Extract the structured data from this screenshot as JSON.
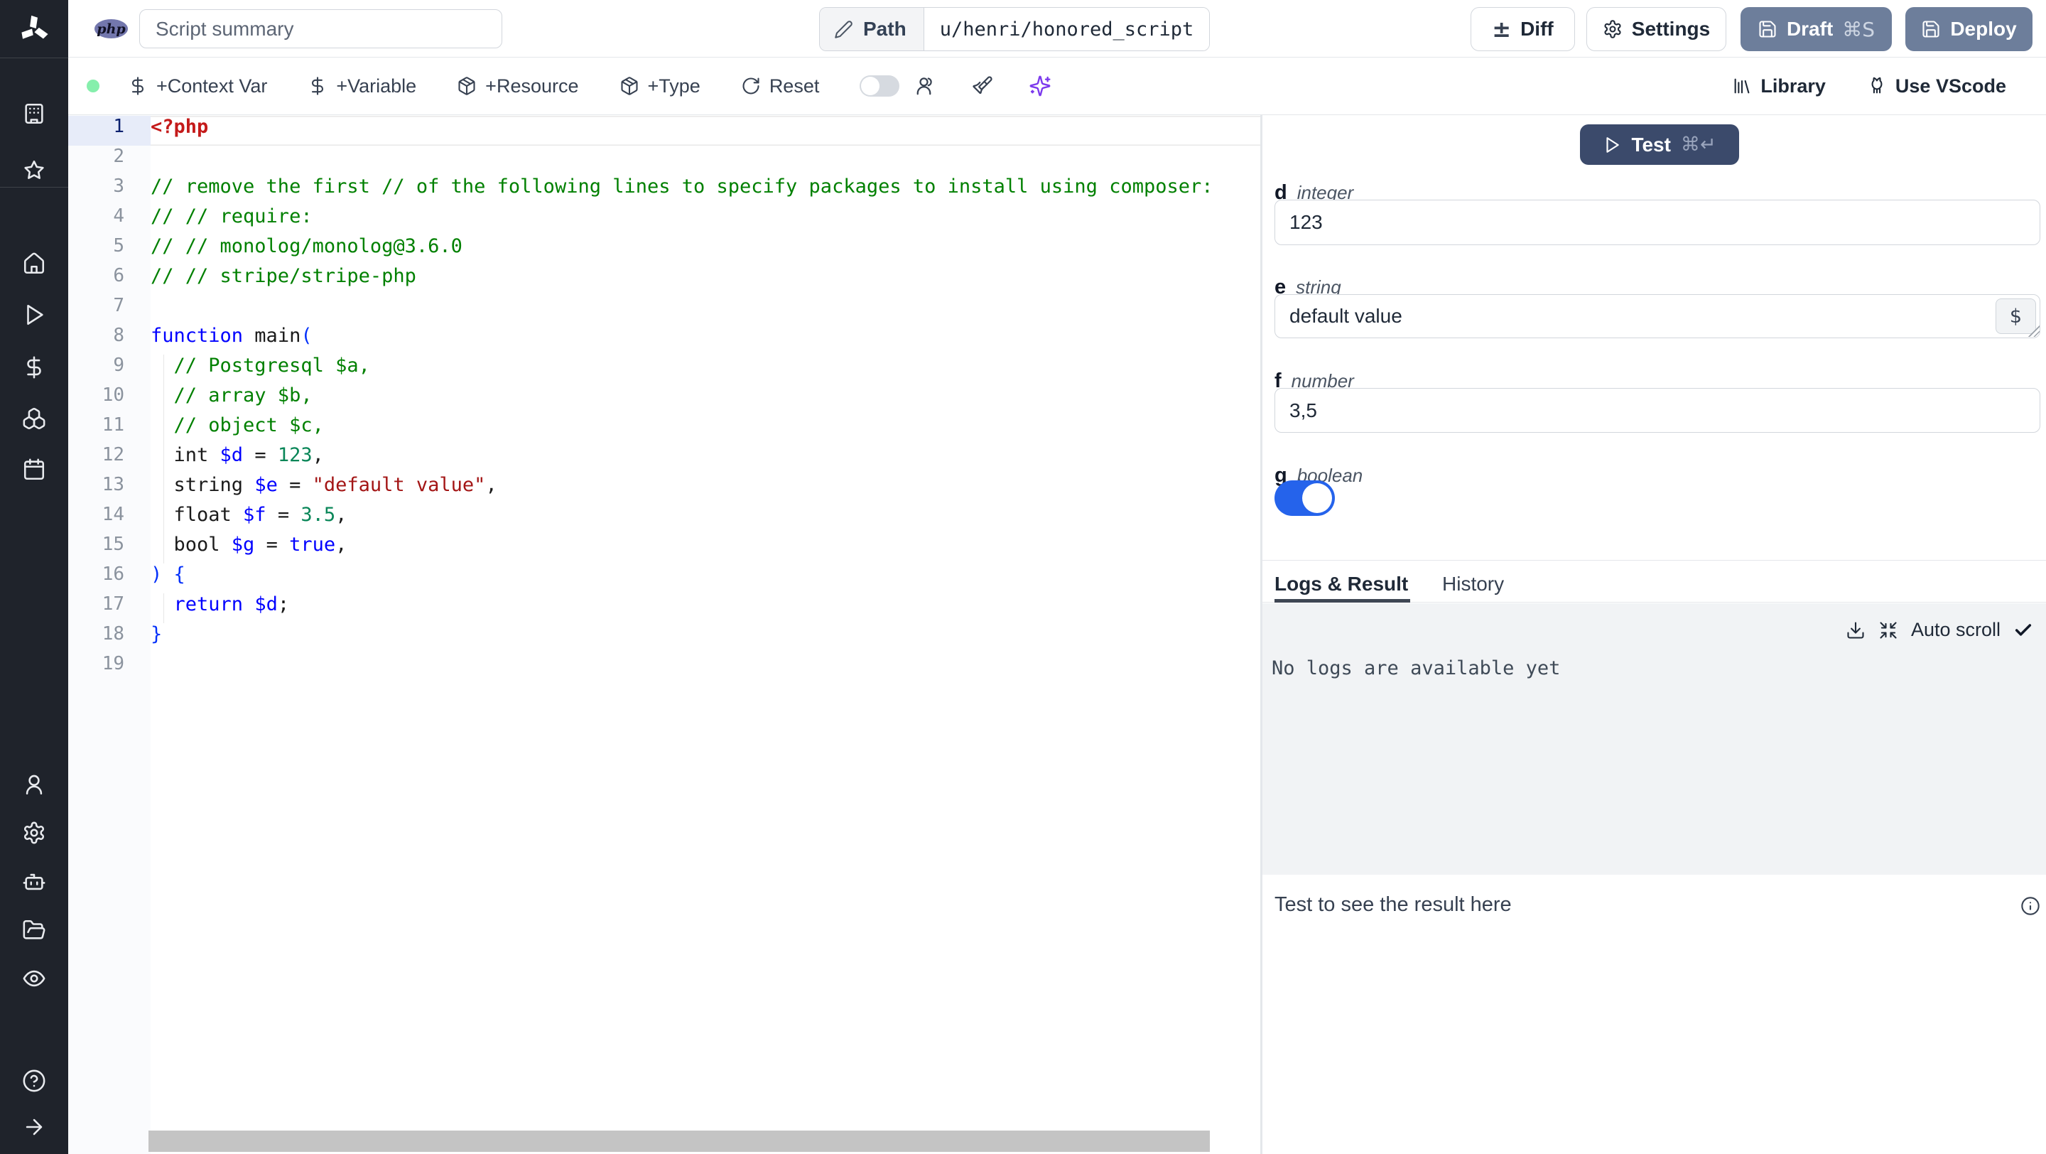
{
  "topbar": {
    "language": "php",
    "summary_placeholder": "Script summary",
    "path_label": "Path",
    "path_value": "u/henri/honored_script",
    "diff": "Diff",
    "settings": "Settings",
    "draft": "Draft",
    "draft_shortcut": "⌘S",
    "deploy": "Deploy"
  },
  "toolbar": {
    "add_context_var": "+Context Var",
    "add_variable": "+Variable",
    "add_resource": "+Resource",
    "add_type": "+Type",
    "reset": "Reset",
    "library": "Library",
    "use_vscode": "Use VScode"
  },
  "editor": {
    "lines": [
      {
        "n": 1,
        "current": true,
        "t": [
          [
            "r",
            "<?php"
          ]
        ]
      },
      {
        "n": 2,
        "t": []
      },
      {
        "n": 3,
        "t": [
          [
            "c",
            "// remove the first // of the following lines to specify packages to install using composer:"
          ]
        ]
      },
      {
        "n": 4,
        "t": [
          [
            "c",
            "// // require:"
          ]
        ]
      },
      {
        "n": 5,
        "t": [
          [
            "c",
            "// // monolog/monolog@3.6.0"
          ]
        ]
      },
      {
        "n": 6,
        "t": [
          [
            "c",
            "// // stripe/stripe-php"
          ]
        ]
      },
      {
        "n": 7,
        "t": []
      },
      {
        "n": 8,
        "t": [
          [
            "k",
            "function"
          ],
          [
            "p",
            " main"
          ],
          [
            "b",
            "("
          ]
        ]
      },
      {
        "n": 9,
        "g": 1,
        "t": [
          [
            "c",
            "  // Postgresql $a,"
          ]
        ]
      },
      {
        "n": 10,
        "g": 1,
        "t": [
          [
            "c",
            "  // array $b,"
          ]
        ]
      },
      {
        "n": 11,
        "g": 1,
        "t": [
          [
            "c",
            "  // object $c,"
          ]
        ]
      },
      {
        "n": 12,
        "g": 1,
        "t": [
          [
            "p",
            "  int "
          ],
          [
            "v",
            "$d"
          ],
          [
            "p",
            " = "
          ],
          [
            "n2",
            "123"
          ],
          [
            "p",
            ","
          ]
        ]
      },
      {
        "n": 13,
        "g": 1,
        "t": [
          [
            "p",
            "  string "
          ],
          [
            "v",
            "$e"
          ],
          [
            "p",
            " = "
          ],
          [
            "s",
            "\"default value\""
          ],
          [
            "p",
            ","
          ]
        ]
      },
      {
        "n": 14,
        "g": 1,
        "t": [
          [
            "p",
            "  float "
          ],
          [
            "v",
            "$f"
          ],
          [
            "p",
            " = "
          ],
          [
            "n2",
            "3.5"
          ],
          [
            "p",
            ","
          ]
        ]
      },
      {
        "n": 15,
        "g": 1,
        "t": [
          [
            "p",
            "  bool "
          ],
          [
            "v",
            "$g"
          ],
          [
            "p",
            " = "
          ],
          [
            "k",
            "true"
          ],
          [
            "p",
            ","
          ]
        ]
      },
      {
        "n": 16,
        "t": [
          [
            "b",
            ") {"
          ]
        ]
      },
      {
        "n": 17,
        "g": 1,
        "t": [
          [
            "p",
            "  "
          ],
          [
            "k",
            "return"
          ],
          [
            "p",
            " "
          ],
          [
            "v",
            "$d"
          ],
          [
            "p",
            ";"
          ]
        ]
      },
      {
        "n": 18,
        "t": [
          [
            "b",
            "}"
          ]
        ]
      },
      {
        "n": 19,
        "t": []
      }
    ]
  },
  "panel": {
    "test": "Test",
    "test_shortcut": "⌘↵",
    "fields": [
      {
        "name": "d",
        "type": "integer",
        "value": "123"
      },
      {
        "name": "e",
        "type": "string",
        "value": "default value",
        "var_button": "$"
      },
      {
        "name": "f",
        "type": "number",
        "value": "3,5"
      },
      {
        "name": "g",
        "type": "boolean",
        "value": "on"
      }
    ],
    "tabs": {
      "logs": "Logs & Result",
      "history": "History"
    },
    "auto_scroll": "Auto scroll",
    "logs_empty": "No logs are available yet",
    "result_placeholder": "Test to see the result here"
  },
  "colors": {
    "deploy_button": "#6d7e9b",
    "test_button": "#3b4a6b",
    "toggle_on": "#2563eb",
    "status_dot": "#86efac",
    "php_badge": "#7377ad",
    "sparkles": "#7c3aed"
  }
}
